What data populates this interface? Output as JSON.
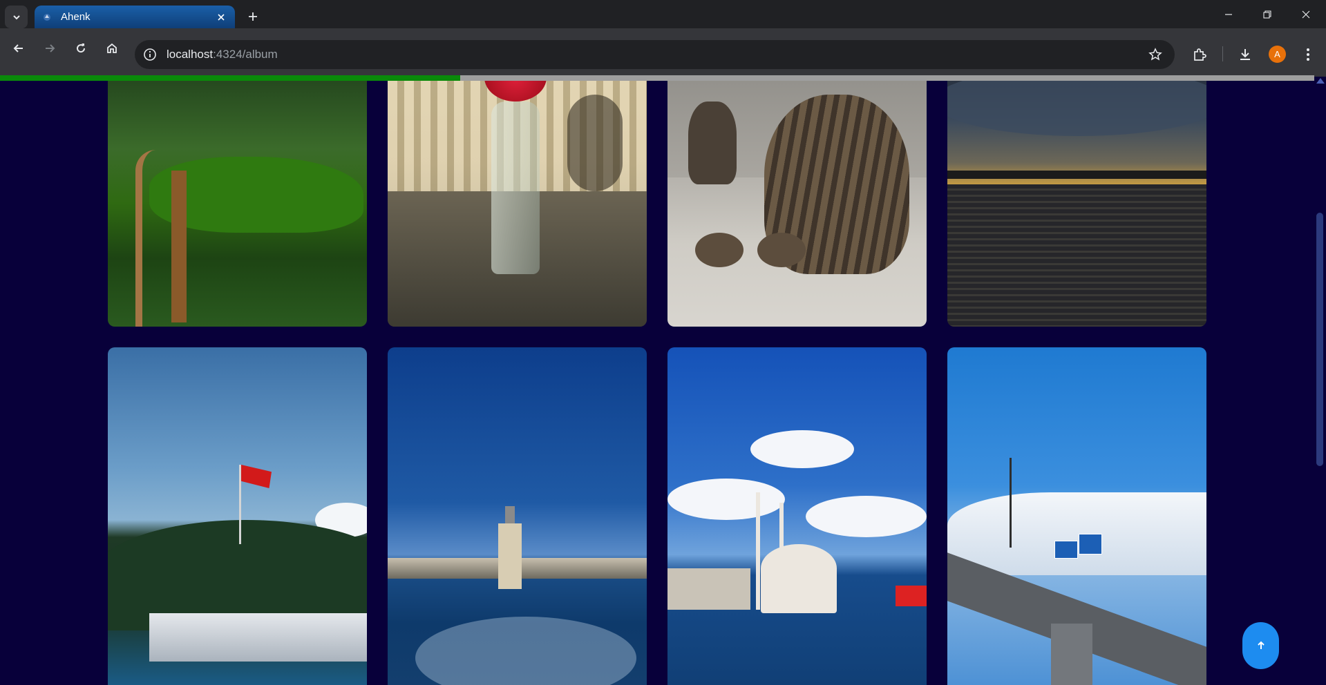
{
  "browser": {
    "tab_title": "Ahenk",
    "url_host": "localhost",
    "url_rest": ":4324/album",
    "avatar_letter": "A"
  },
  "page": {
    "loading_progress_percent": 35,
    "photos": [
      {
        "subject": "green pond with rope fence"
      },
      {
        "subject": "red carnations in a bottle vase"
      },
      {
        "subject": "stretching tabby cat"
      },
      {
        "subject": "sunset over the sea"
      },
      {
        "subject": "hill with Turkish flag by the water"
      },
      {
        "subject": "Maiden's Tower from a boat"
      },
      {
        "subject": "Ortaköy Mosque by the Bosphorus"
      },
      {
        "subject": "bridge under a blue sky"
      }
    ]
  },
  "colors": {
    "page_background": "#08003a",
    "progress_fill": "#0a8a0a",
    "back_to_top": "#1d8cf0"
  }
}
